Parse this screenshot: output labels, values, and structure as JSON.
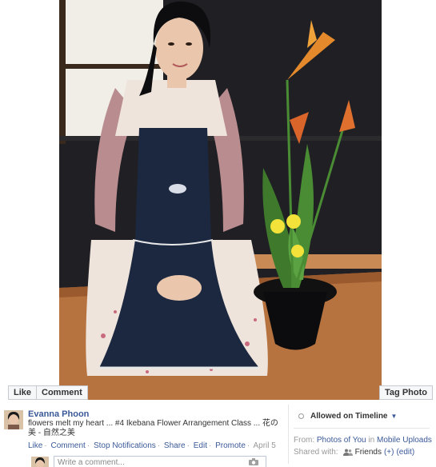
{
  "photo": {
    "buttons": {
      "like": "Like",
      "comment": "Comment",
      "tag_photo": "Tag Photo"
    }
  },
  "post": {
    "author": "Evanna Phoon",
    "caption": "flowers melt my heart ... #4 Ikebana Flower Arrangement Class ... 花の美 - 自然之美",
    "actions": {
      "like": "Like",
      "comment": "Comment",
      "stop_notifications": "Stop Notifications",
      "share": "Share",
      "edit": "Edit",
      "promote": "Promote",
      "date": "April 5"
    },
    "comment_placeholder": "Write a comment..."
  },
  "sidebar": {
    "allowed_on_timeline": "Allowed on Timeline",
    "from_label": "From:",
    "from_album": "Photos of You",
    "from_in": "in",
    "from_source": "Mobile Uploads",
    "shared_label": "Shared with:",
    "shared_value": "Friends",
    "shared_plus": "(+)",
    "shared_edit": "(edit)"
  },
  "icons": {
    "timeline_status": "circle-icon",
    "timeline_menu": "caret-down-icon",
    "camera": "camera-icon",
    "friends": "friends-icon"
  },
  "colors": {
    "link": "#3b5998",
    "muted": "#999999"
  }
}
